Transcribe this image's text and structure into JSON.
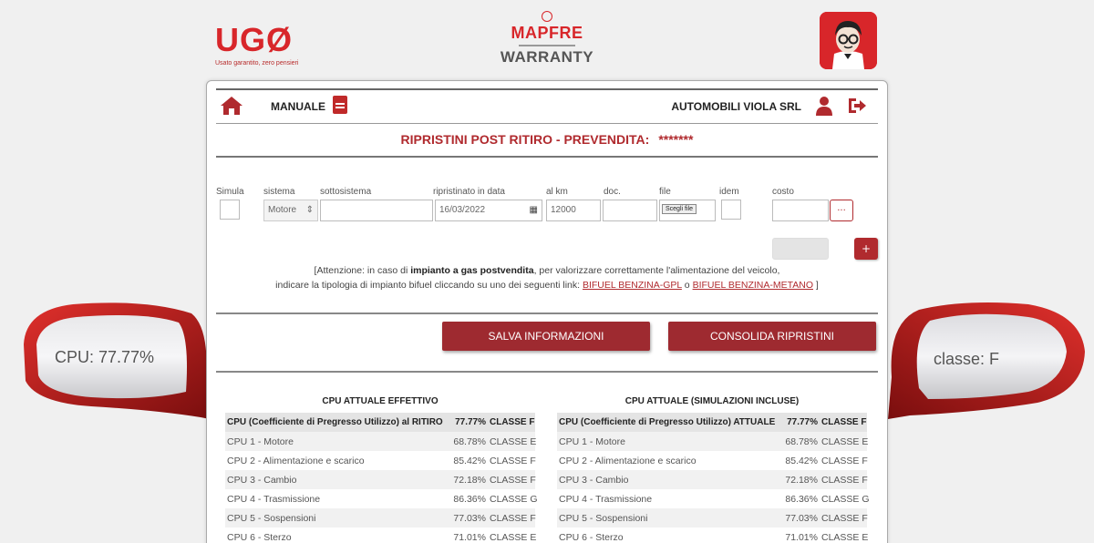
{
  "brand": {
    "ugo": "UGØ",
    "ugo_tagline": "Usato garantito, zero pensieri",
    "mapfre": "MAPFRE",
    "warranty": "WARRANTY"
  },
  "mirrors": {
    "left": "CPU: 77.77%",
    "right": "classe: F"
  },
  "nav": {
    "manual": "MANUALE",
    "company": "AUTOMOBILI VIOLA SRL"
  },
  "title": {
    "text": "RIPRISTINI POST RITIRO - PREVENDITA:",
    "stars": "*******"
  },
  "form": {
    "labels": {
      "simula": "Simula",
      "sistema": "sistema",
      "sottosistema": "sottosistema",
      "ripristinato": "ripristinato in data",
      "km": "al km",
      "doc": "doc.",
      "file": "file",
      "idem": "idem",
      "costo": "costo"
    },
    "sistema_value": "Motore",
    "date_value": "16/03/2022",
    "km_value": "12000",
    "file_button": "Scegli file",
    "dots_button": "...",
    "plus_button": "+"
  },
  "notice": {
    "pre": "[Attenzione: in caso di ",
    "bold": "impianto a gas postvendita",
    "mid": ", per valorizzare correttamente l'alimentazione del veicolo,",
    "line2": "indicare la tipologia di impianto bifuel cliccando su uno dei seguenti link: ",
    "link1": "BIFUEL BENZINA-GPL",
    "or": " o ",
    "link2": "BIFUEL BENZINA-METANO",
    "end": " ]"
  },
  "buttons": {
    "salva": "SALVA INFORMAZIONI",
    "consolida": "CONSOLIDA RIPRISTINI"
  },
  "table_left": {
    "title": "CPU ATTUALE EFFETTIVO",
    "head": [
      "CPU (Coefficiente di Pregresso Utilizzo) al RITIRO",
      "77.77%",
      "CLASSE F"
    ],
    "rows": [
      [
        "CPU 1 - Motore",
        "68.78%",
        "CLASSE E"
      ],
      [
        "CPU 2 - Alimentazione e scarico",
        "85.42%",
        "CLASSE F"
      ],
      [
        "CPU 3 - Cambio",
        "72.18%",
        "CLASSE F"
      ],
      [
        "CPU 4 - Trasmissione",
        "86.36%",
        "CLASSE G"
      ],
      [
        "CPU 5 - Sospensioni",
        "77.03%",
        "CLASSE F"
      ],
      [
        "CPU 6 - Sterzo",
        "71.01%",
        "CLASSE E"
      ]
    ]
  },
  "table_right": {
    "title": "CPU ATTUALE (SIMULAZIONI INCLUSE)",
    "head": [
      "CPU (Coefficiente di Pregresso Utilizzo) ATTUALE",
      "77.77%",
      "CLASSE F"
    ],
    "rows": [
      [
        "CPU 1 - Motore",
        "68.78%",
        "CLASSE E"
      ],
      [
        "CPU 2 - Alimentazione e scarico",
        "85.42%",
        "CLASSE F"
      ],
      [
        "CPU 3 - Cambio",
        "72.18%",
        "CLASSE F"
      ],
      [
        "CPU 4 - Trasmissione",
        "86.36%",
        "CLASSE G"
      ],
      [
        "CPU 5 - Sospensioni",
        "77.03%",
        "CLASSE F"
      ],
      [
        "CPU 6 - Sterzo",
        "71.01%",
        "CLASSE E"
      ]
    ]
  },
  "colors": {
    "brand_red": "#d8262a",
    "button_red": "#9e2a30"
  }
}
